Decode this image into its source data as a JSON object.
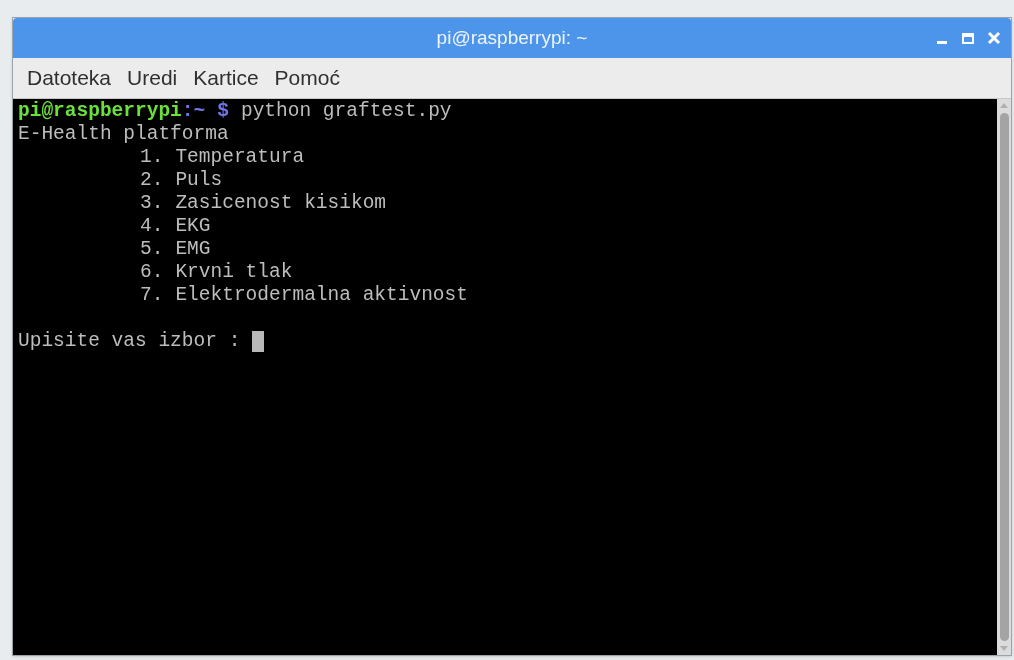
{
  "window": {
    "title": "pi@raspberrypi: ~"
  },
  "menu": [
    "Datoteka",
    "Uredi",
    "Kartice",
    "Pomoć"
  ],
  "terminal": {
    "prompt": {
      "user_host": "pi@raspberrypi",
      "separator": ":",
      "path": "~",
      "symbol": "$",
      "command": "python graftest.py"
    },
    "heading": "E-Health platforma",
    "options": [
      {
        "number": "1.",
        "label": "Temperatura"
      },
      {
        "number": "2.",
        "label": "Puls"
      },
      {
        "number": "3.",
        "label": "Zasicenost kisikom"
      },
      {
        "number": "4.",
        "label": "EKG"
      },
      {
        "number": "5.",
        "label": "EMG"
      },
      {
        "number": "6.",
        "label": "Krvni tlak"
      },
      {
        "number": "7.",
        "label": "Elektrodermalna aktivnost"
      }
    ],
    "input_prompt": "Upisite vas izbor :"
  }
}
